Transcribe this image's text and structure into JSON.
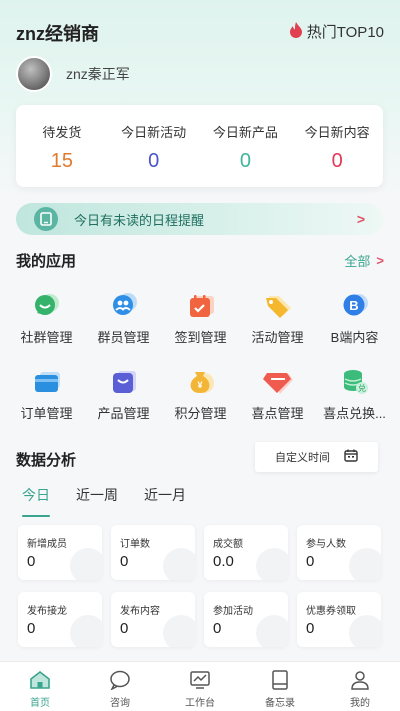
{
  "header": {
    "app_title": "znz经销商",
    "hot_label": "热门TOP10"
  },
  "user": {
    "name": "znz秦正军"
  },
  "stats": [
    {
      "label": "待发货",
      "value": "15",
      "color": "#e07a2e"
    },
    {
      "label": "今日新活动",
      "value": "0",
      "color": "#4a56c8"
    },
    {
      "label": "今日新产品",
      "value": "0",
      "color": "#3fb39c"
    },
    {
      "label": "今日新内容",
      "value": "0",
      "color": "#e03a55"
    }
  ],
  "reminder": {
    "text": "今日有未读的日程提醒",
    "arrow": ">"
  },
  "apps_section": {
    "title": "我的应用",
    "all_label": "全部",
    "all_chevron": ">"
  },
  "apps": [
    {
      "label": "社群管理",
      "icon": "community-icon",
      "color": "#35b36b"
    },
    {
      "label": "群员管理",
      "icon": "members-icon",
      "color": "#2f8fe6"
    },
    {
      "label": "签到管理",
      "icon": "checkin-icon",
      "color": "#f0653f"
    },
    {
      "label": "活动管理",
      "icon": "tag-icon",
      "color": "#f5b72d"
    },
    {
      "label": "B端内容",
      "icon": "b-content-icon",
      "color": "#2f7fe6"
    },
    {
      "label": "订单管理",
      "icon": "order-icon",
      "color": "#2b8fe0"
    },
    {
      "label": "产品管理",
      "icon": "product-bag-icon",
      "color": "#5b5fd6"
    },
    {
      "label": "积分管理",
      "icon": "points-icon",
      "color": "#f3b536"
    },
    {
      "label": "喜点管理",
      "icon": "diamond-icon",
      "color": "#ef5b4e"
    },
    {
      "label": "喜点兑换...",
      "icon": "exchange-coins-icon",
      "color": "#3dbb7a"
    }
  ],
  "analytics": {
    "title": "数据分析",
    "custom_time": "自定义时间",
    "tabs": [
      {
        "label": "今日",
        "active": true
      },
      {
        "label": "近一周",
        "active": false
      },
      {
        "label": "近一月",
        "active": false
      }
    ],
    "metrics": [
      {
        "label": "新增成员",
        "value": "0",
        "icon": "add-user-icon"
      },
      {
        "label": "订单数",
        "value": "0",
        "icon": "order-doc-icon"
      },
      {
        "label": "成交额",
        "value": "0.0",
        "icon": "coins-icon"
      },
      {
        "label": "参与人数",
        "value": "0",
        "icon": "people-icon"
      },
      {
        "label": "发布接龙",
        "value": "0",
        "icon": "relay-icon"
      },
      {
        "label": "发布内容",
        "value": "0",
        "icon": "send-icon"
      },
      {
        "label": "参加活动",
        "value": "0",
        "icon": "balloon-icon"
      },
      {
        "label": "优惠券领取",
        "value": "0",
        "icon": "coupon-icon"
      }
    ]
  },
  "tabbar": [
    {
      "label": "首页",
      "icon": "home-icon",
      "active": true
    },
    {
      "label": "咨询",
      "icon": "chat-icon",
      "active": false
    },
    {
      "label": "工作台",
      "icon": "workbench-icon",
      "active": false
    },
    {
      "label": "备忘录",
      "icon": "memo-icon",
      "active": false
    },
    {
      "label": "我的",
      "icon": "profile-icon",
      "active": false
    }
  ]
}
